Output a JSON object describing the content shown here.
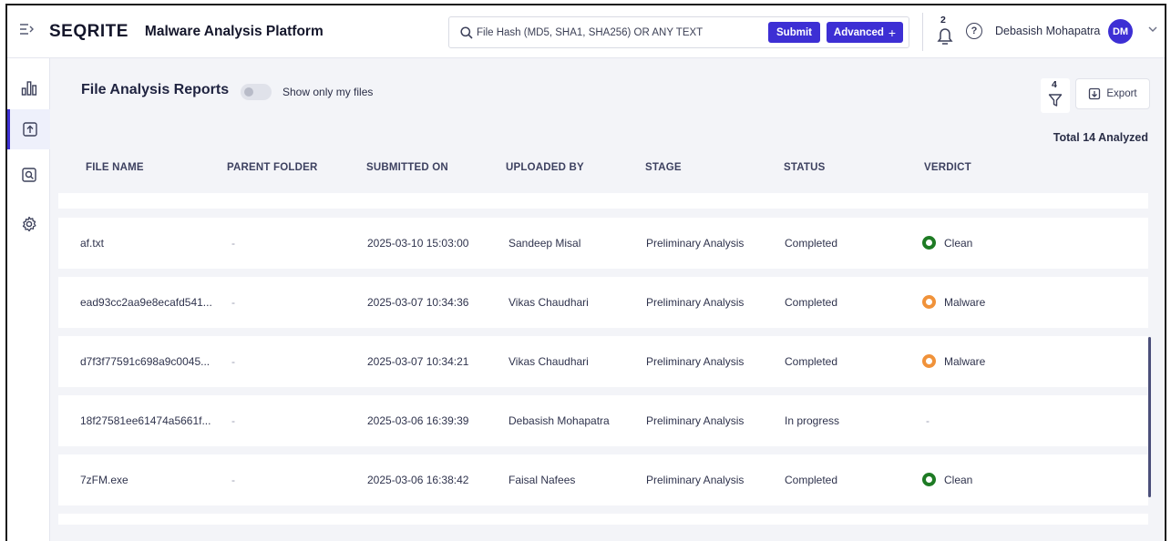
{
  "header": {
    "brand_pre": "SEQ",
    "brand_post": "RITE",
    "app_title": "Malware Analysis Platform",
    "search_placeholder": "File Hash (MD5, SHA1, SHA256) OR ANY TEXT",
    "submit_label": "Submit",
    "advanced_label": "Advanced",
    "notification_count": "2",
    "help_glyph": "?",
    "user_name": "Debasish Mohapatra",
    "user_initials": "DM"
  },
  "sidebar": {
    "items": [
      {
        "name": "dashboard-chart-icon",
        "active": false
      },
      {
        "name": "upload-reports-icon",
        "active": true
      },
      {
        "name": "search-report-icon",
        "active": false
      },
      {
        "name": "settings-gear-icon",
        "active": false
      }
    ]
  },
  "page": {
    "title": "File Analysis Reports",
    "toggle_label": "Show only my files",
    "toggle_on": false,
    "filter_count": "4",
    "export_label": "Export",
    "total_label": "Total 14 Analyzed"
  },
  "table": {
    "columns": [
      "FILE NAME",
      "PARENT FOLDER",
      "SUBMITTED ON",
      "UPLOADED BY",
      "STAGE",
      "STATUS",
      "VERDICT"
    ],
    "rows": [
      {
        "file_name": "af.txt",
        "parent_folder": "-",
        "submitted_on": "2025-03-10 15:03:00",
        "uploaded_by": "Sandeep Misal",
        "stage": "Preliminary Analysis",
        "status": "Completed",
        "verdict": "Clean",
        "verdict_type": "clean"
      },
      {
        "file_name": "ead93cc2aa9e8ecafd541...",
        "parent_folder": "-",
        "submitted_on": "2025-03-07 10:34:36",
        "uploaded_by": "Vikas Chaudhari",
        "stage": "Preliminary Analysis",
        "status": "Completed",
        "verdict": "Malware",
        "verdict_type": "malware"
      },
      {
        "file_name": "d7f3f77591c698a9c0045...",
        "parent_folder": "-",
        "submitted_on": "2025-03-07 10:34:21",
        "uploaded_by": "Vikas Chaudhari",
        "stage": "Preliminary Analysis",
        "status": "Completed",
        "verdict": "Malware",
        "verdict_type": "malware"
      },
      {
        "file_name": "18f27581ee61474a5661f...",
        "parent_folder": "-",
        "submitted_on": "2025-03-06 16:39:39",
        "uploaded_by": "Debasish Mohapatra",
        "stage": "Preliminary Analysis",
        "status": "In progress",
        "verdict": "-",
        "verdict_type": "none"
      },
      {
        "file_name": "7zFM.exe",
        "parent_folder": "-",
        "submitted_on": "2025-03-06 16:38:42",
        "uploaded_by": "Faisal Nafees",
        "stage": "Preliminary Analysis",
        "status": "Completed",
        "verdict": "Clean",
        "verdict_type": "clean"
      }
    ]
  },
  "colors": {
    "accent": "#3d2fd4",
    "clean": "#1e7b24",
    "malware": "#f0923a",
    "brand_red": "#c62828"
  }
}
